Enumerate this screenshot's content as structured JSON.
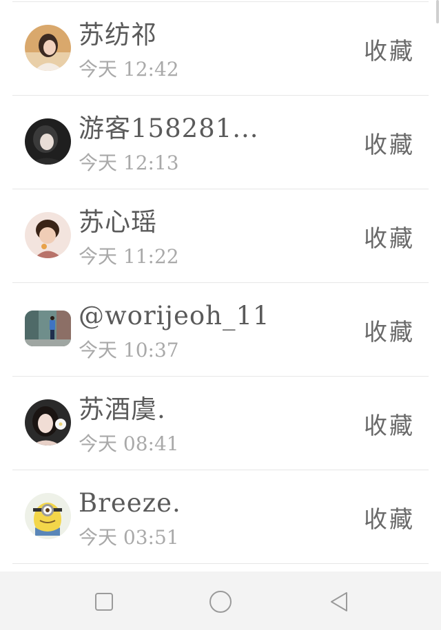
{
  "contacts": [
    {
      "name": "苏纺祁",
      "time": "今天 12:42",
      "action": "收藏",
      "avatar": "avatar-girl-warm-icon"
    },
    {
      "name": "游客158281...",
      "time": "今天 12:13",
      "action": "收藏",
      "avatar": "avatar-girl-dark-icon"
    },
    {
      "name": "苏心瑶",
      "time": "今天 11:22",
      "action": "收藏",
      "avatar": "avatar-child-icon"
    },
    {
      "name": "@worijeoh_11",
      "time": "今天 10:37",
      "action": "收藏",
      "avatar": "avatar-street-icon"
    },
    {
      "name": "苏酒虞.",
      "time": "今天 08:41",
      "action": "收藏",
      "avatar": "avatar-flower-girl-icon"
    },
    {
      "name": "Breeze.",
      "time": "今天 03:51",
      "action": "收藏",
      "avatar": "avatar-minion-icon"
    }
  ],
  "navbar": {
    "icons": [
      "recent-apps-square-icon",
      "home-circle-icon",
      "back-triangle-icon"
    ]
  }
}
